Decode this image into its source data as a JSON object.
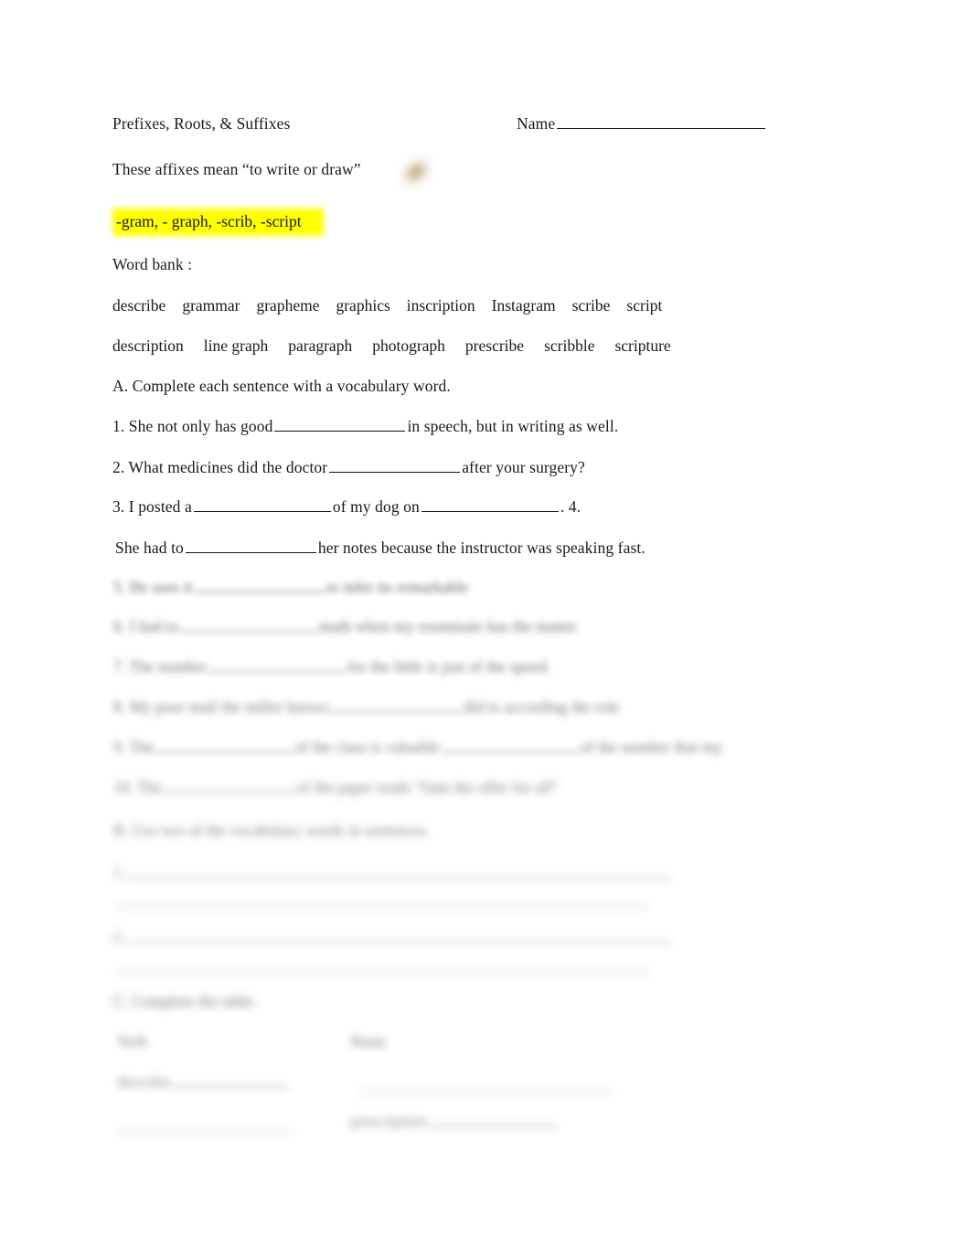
{
  "document": {
    "header": {
      "title": "Prefixes, Roots, & Suffixes",
      "name_label": "Name"
    },
    "affixes": {
      "intro": "These affixes mean “to write or draw”",
      "list": "-gram, - graph, -scrib, -script",
      "highlight_color": "#ffff00",
      "smudge_color": "#a07a46"
    },
    "word_bank": {
      "label": "Word bank :",
      "row1": [
        "describe",
        "grammar",
        "grapheme",
        "graphics",
        "inscription",
        "Instagram",
        "scribe",
        "script"
      ],
      "row2": [
        "description",
        "line graph",
        "paragraph",
        "photograph",
        "prescribe",
        "scribble",
        "scripture"
      ]
    },
    "section_a": {
      "heading": "A. Complete each sentence with a vocabulary word.",
      "q1_pre": "1. She not only has good",
      "q1_post": "in speech, but in writing as well.",
      "q2_pre": "2. What medicines did the doctor",
      "q2_post": "after your surgery?",
      "q3_pre": "3. I posted a",
      "q3_mid": "of my dog on",
      "q3_post": ". 4.",
      "q4_pre": "She had to",
      "q4_post": "her notes because the instructor was speaking fast."
    },
    "redacted": {
      "note": "Lower portion of page is blurred/illegible in the source image.",
      "q5_pre": "5. He uses it",
      "q5_post": "to infer its remarkable",
      "q6_pre": "6. I had to",
      "q6_post": "math when my roommate has the matter",
      "q7_pre": "7. The number",
      "q7_post": "for the little is just of the speed.",
      "q8_pre": "8. My poor mail the miller knows",
      "q8_post": "did to according the role",
      "q9_pre": "9. The",
      "q9_mid": "of the class is valuable",
      "q9_post": "of the number that my",
      "q10_pre": "10. The",
      "q10_post": "of the paper reads “Sam the offer for all”",
      "section_b_heading": "B. Use two of the vocabulary words in sentences.",
      "b_item1": "5.",
      "b_item2": "6.",
      "section_c_heading": "C. Complete the table.",
      "col1_header": "Verb",
      "col2_header": "Noun",
      "col1_r1": "describe",
      "col2_r2": "prescription"
    }
  }
}
